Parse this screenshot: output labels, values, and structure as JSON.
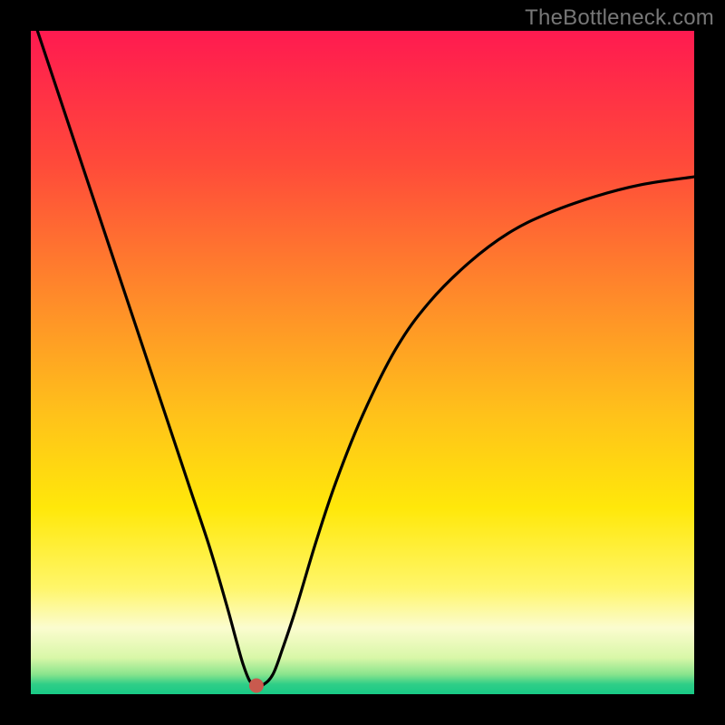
{
  "watermark_text": "TheBottleneck.com",
  "chart_data": {
    "type": "line",
    "title": "",
    "xlabel": "",
    "ylabel": "",
    "xlim": [
      0,
      100
    ],
    "ylim": [
      0,
      100
    ],
    "grid": false,
    "legend": false,
    "gradient_stops": [
      {
        "offset": 0.0,
        "color": "#ff1a50"
      },
      {
        "offset": 0.2,
        "color": "#ff4a3a"
      },
      {
        "offset": 0.4,
        "color": "#ff8a2a"
      },
      {
        "offset": 0.58,
        "color": "#ffc21a"
      },
      {
        "offset": 0.72,
        "color": "#ffe80a"
      },
      {
        "offset": 0.84,
        "color": "#fff66a"
      },
      {
        "offset": 0.9,
        "color": "#fbfccf"
      },
      {
        "offset": 0.945,
        "color": "#d9f7a8"
      },
      {
        "offset": 0.97,
        "color": "#8ae48d"
      },
      {
        "offset": 0.985,
        "color": "#2fce87"
      },
      {
        "offset": 1.0,
        "color": "#18c986"
      }
    ],
    "series": [
      {
        "name": "bottleneck-curve",
        "x": [
          1.0,
          4.0,
          8.0,
          12.0,
          16.0,
          20.0,
          24.0,
          27.0,
          29.5,
          31.0,
          32.0,
          33.0,
          34.0,
          35.0,
          36.5,
          38.0,
          40.0,
          43.0,
          46.0,
          50.0,
          55.0,
          60.0,
          66.0,
          72.0,
          78.0,
          85.0,
          92.0,
          100.0
        ],
        "y": [
          100.0,
          91.0,
          79.0,
          67.0,
          55.0,
          43.0,
          31.0,
          22.0,
          13.5,
          8.0,
          4.5,
          2.0,
          1.3,
          1.4,
          3.0,
          7.0,
          13.0,
          23.0,
          32.0,
          42.0,
          52.0,
          59.0,
          65.0,
          69.5,
          72.5,
          75.0,
          76.8,
          78.0
        ]
      }
    ],
    "marker": {
      "x": 34.0,
      "y": 1.3,
      "color": "#c95a4e",
      "radius_px": 8
    },
    "flat_bottom": {
      "x_start": 31.5,
      "x_end": 34.0,
      "y": 1.3
    }
  }
}
